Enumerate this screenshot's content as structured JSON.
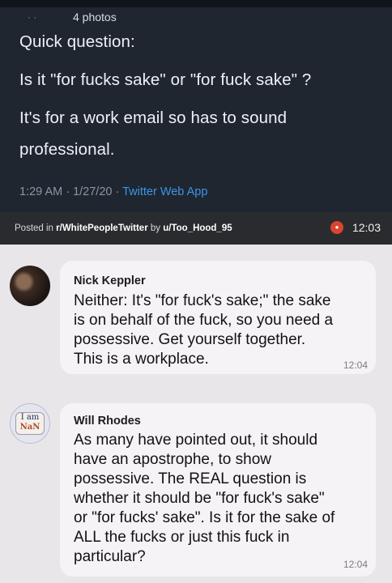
{
  "tweet": {
    "photos_count": "4 photos",
    "lines": [
      "Quick question:",
      "Is it \"for fucks sake\" or \"for fuck sake\" ?",
      "It's for a work email so has to sound",
      "professional."
    ],
    "meta": "1:29 AM · 1/27/20 · ",
    "app": "Twitter Web App"
  },
  "reddit": {
    "posted_prefix": "Posted in ",
    "subreddit": "r/WhitePeopleTwitter",
    "by": " by ",
    "user": "u/Too_Hood_95",
    "time": "12:03"
  },
  "comments": [
    {
      "name": "Nick Keppler",
      "lines": [
        "Neither: It's \"for fuck's sake;\" the sake",
        "is on behalf of the fuck, so you need a",
        "possessive. Get yourself together.",
        "This is a workplace."
      ],
      "time": "12:04"
    },
    {
      "name": "Will Rhodes",
      "avatar_text": "I am NaN",
      "lines": [
        "As many have pointed out, it should",
        "have an apostrophe, to show",
        "possessive. The REAL question is",
        "whether it should be \"for fuck's sake\"",
        "or \"for fucks' sake\". Is it for the sake of",
        "ALL the fucks or just this fuck in",
        "particular?"
      ],
      "time": "12:04"
    }
  ]
}
